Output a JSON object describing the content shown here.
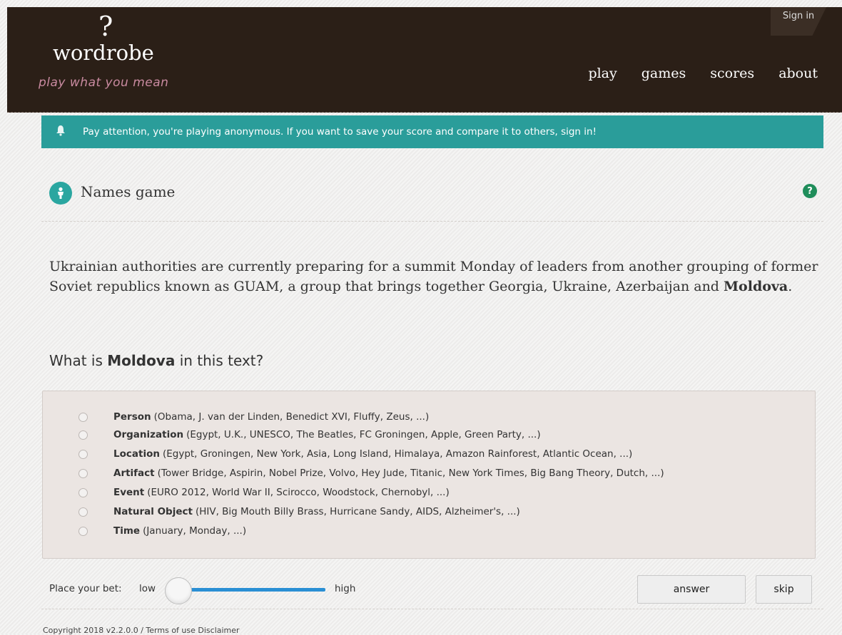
{
  "header": {
    "logo_mark": "?",
    "logo_text": "wordrobe",
    "tagline": "play what you mean",
    "sign_in": "Sign in",
    "nav": [
      "play",
      "games",
      "scores",
      "about"
    ]
  },
  "alert": {
    "text": "Pay attention, you're playing anonymous. If you want to save your score and compare it to others, sign in!"
  },
  "game": {
    "title": "Names game",
    "help": "?"
  },
  "passage": {
    "text_before": "Ukrainian authorities are currently preparing for a summit Monday of leaders from another grouping of former Soviet republics known as GUAM, a group that brings together Georgia, Ukraine, Azerbaijan and ",
    "highlight": "Moldova",
    "text_after": "."
  },
  "question": {
    "before": "What is ",
    "term": "Moldova",
    "after": " in this text?"
  },
  "options": [
    {
      "label": "Person",
      "examples": "(Obama, J. van der Linden, Benedict XVI, Fluffy, Zeus, ...)"
    },
    {
      "label": "Organization",
      "examples": "(Egypt, U.K., UNESCO, The Beatles, FC Groningen, Apple, Green Party, ...)"
    },
    {
      "label": "Location",
      "examples": "(Egypt, Groningen, New York, Asia, Long Island, Himalaya, Amazon Rainforest, Atlantic Ocean, ...)"
    },
    {
      "label": "Artifact",
      "examples": "(Tower Bridge, Aspirin, Nobel Prize, Volvo, Hey Jude, Titanic, New York Times, Big Bang Theory, Dutch, ...)"
    },
    {
      "label": "Event",
      "examples": "(EURO 2012, World War II, Scirocco, Woodstock, Chernobyl, ...)"
    },
    {
      "label": "Natural Object",
      "examples": "(HIV, Big Mouth Billy Brass, Hurricane Sandy, AIDS, Alzheimer's, ...)"
    },
    {
      "label": "Time",
      "examples": "(January, Monday, ...)"
    }
  ],
  "bet": {
    "label": "Place your bet:",
    "low": "low",
    "high": "high",
    "level": 0
  },
  "buttons": {
    "answer": "answer",
    "skip": "skip"
  },
  "footer": {
    "text": "Copyright 2018 v2.2.0.0 / Terms of use Disclaimer"
  },
  "colors": {
    "header_bg": "#2b1f17",
    "alert_bg": "#2a9d9a",
    "accent_teal": "#2aa6a0",
    "help_green": "#1f8d5a",
    "slider_blue": "#2a8fd4",
    "tagline_pink": "#c98aa0"
  },
  "icons": {
    "alert": "bell-icon",
    "game": "person-icon",
    "help": "question-icon"
  }
}
